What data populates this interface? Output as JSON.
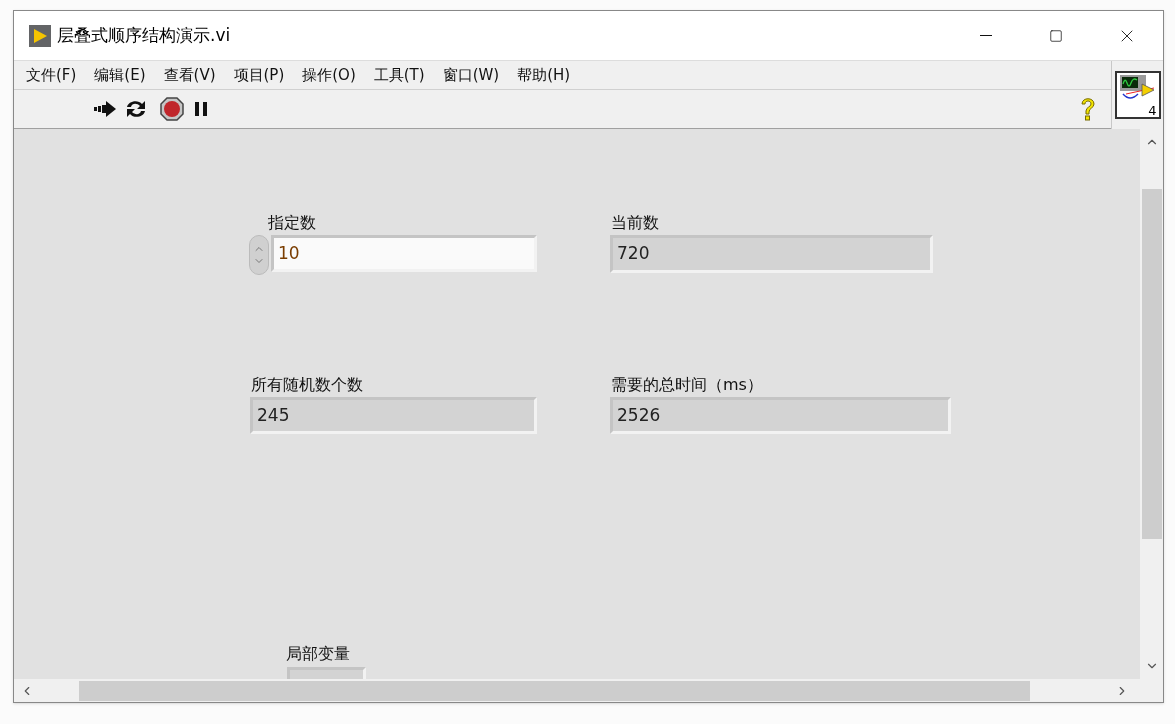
{
  "window": {
    "title": "层叠式顺序结构演示.vi"
  },
  "menu": [
    "文件(F)",
    "编辑(E)",
    "查看(V)",
    "项目(P)",
    "操作(O)",
    "工具(T)",
    "窗口(W)",
    "帮助(H)"
  ],
  "icon_badge": "4",
  "controls": [
    {
      "kind": "control",
      "label": "指定数",
      "value": "10"
    },
    {
      "kind": "indicator",
      "label": "当前数",
      "value": "720"
    },
    {
      "kind": "indicator",
      "label": "所有随机数个数",
      "value": "245"
    },
    {
      "kind": "indicator",
      "label": "需要的总时间（ms）",
      "value": "2526"
    },
    {
      "kind": "indicator",
      "label": "局部变量"
    }
  ]
}
